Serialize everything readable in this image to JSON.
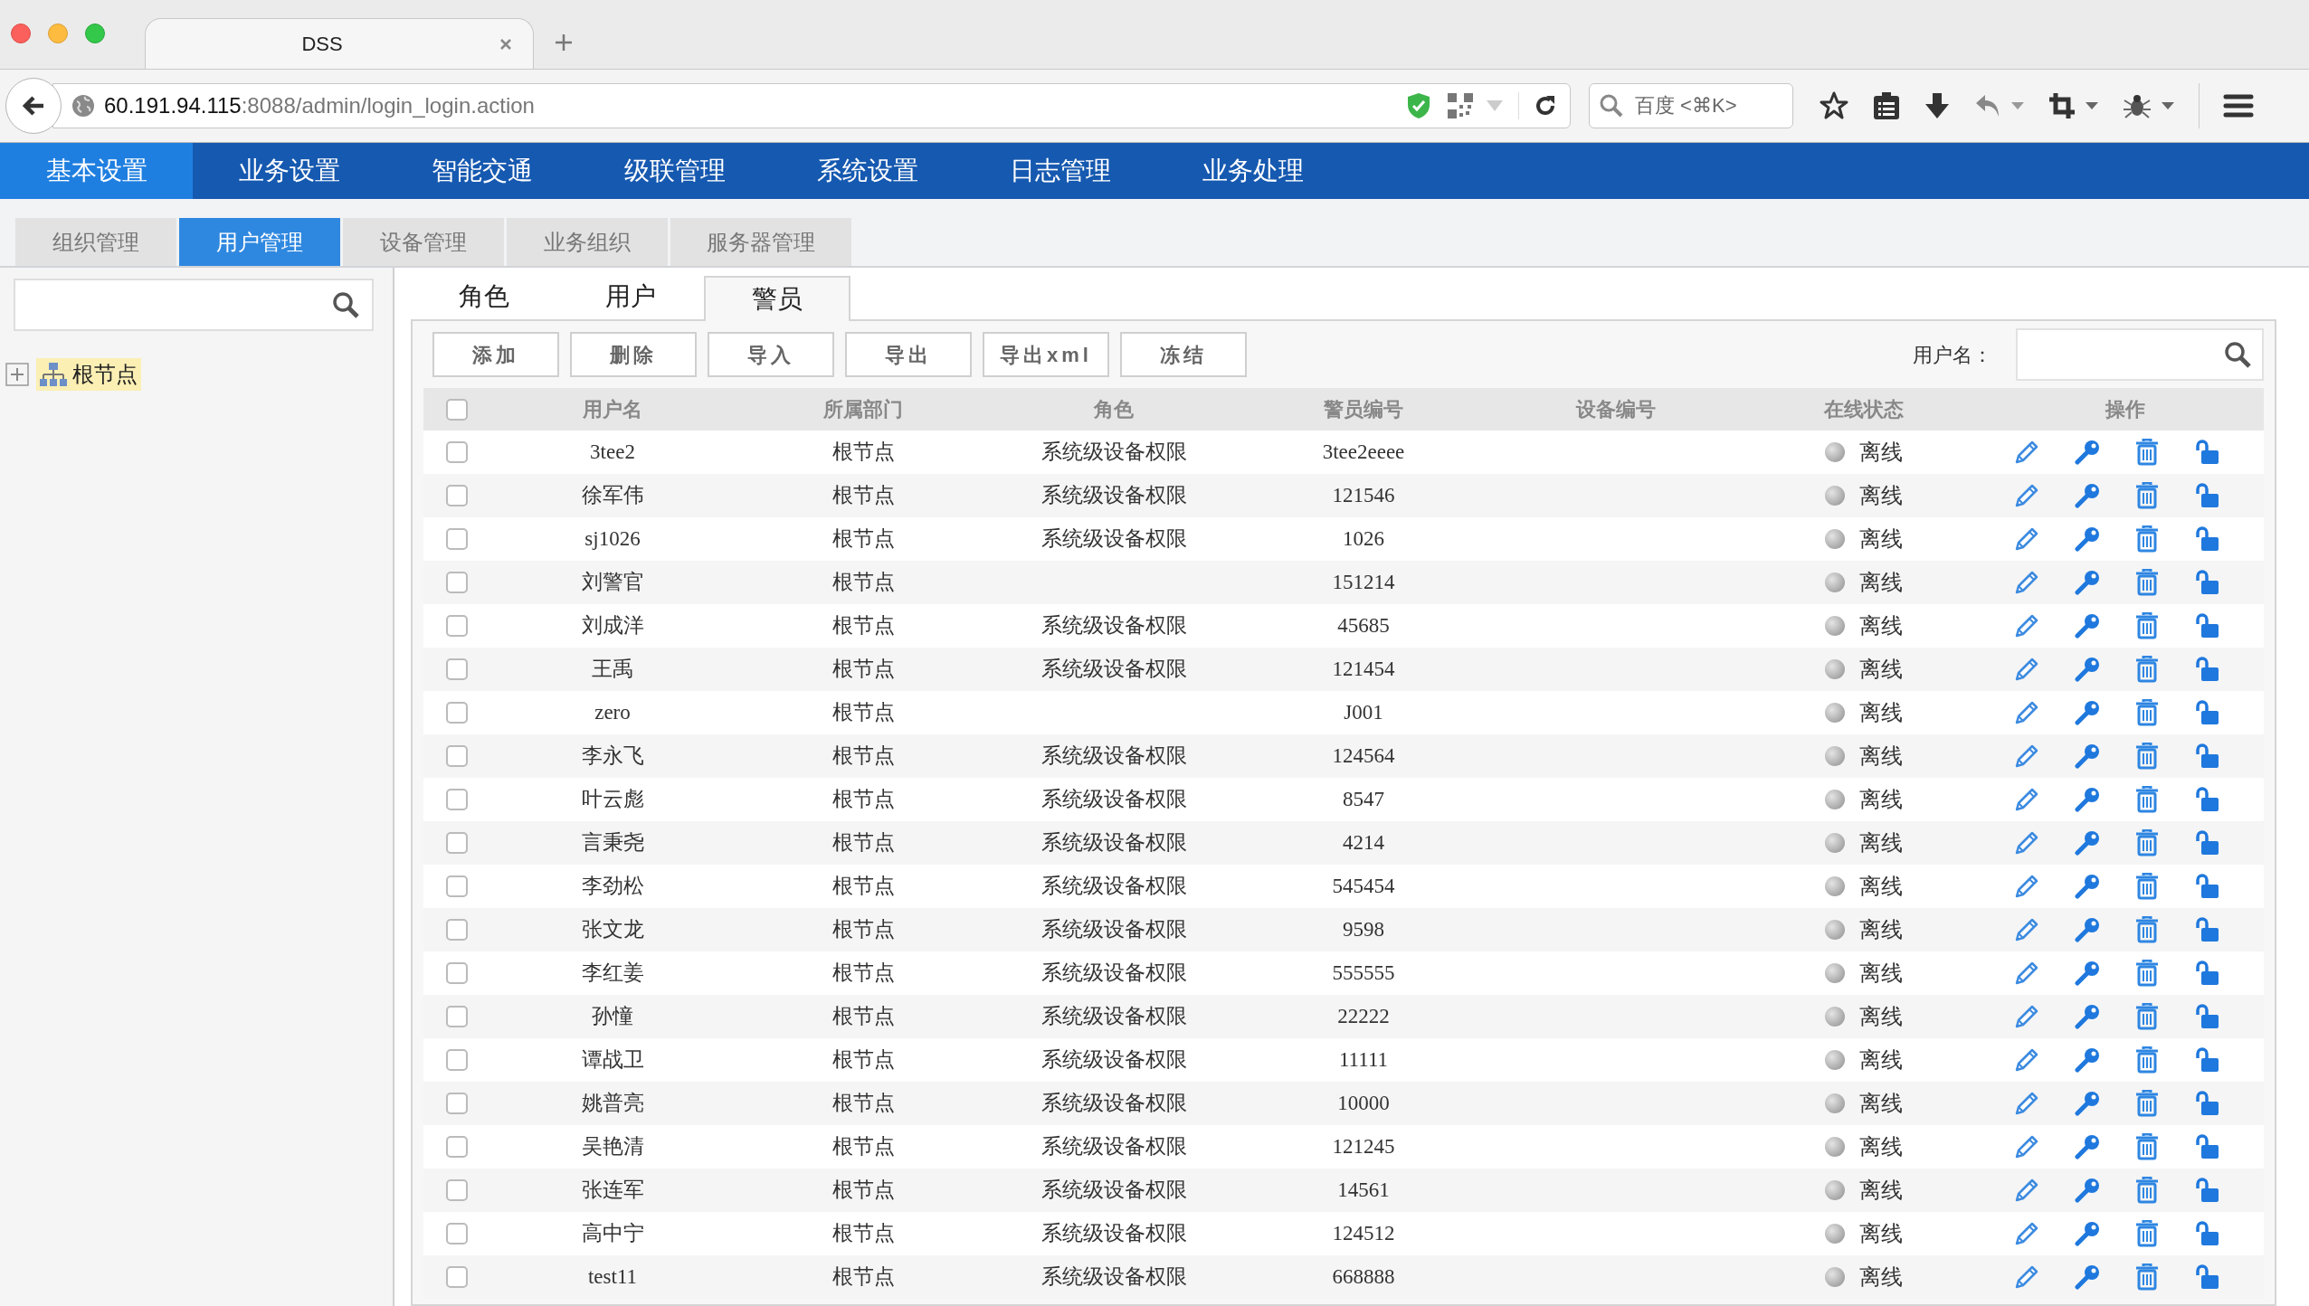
{
  "browser": {
    "tab_title": "DSS",
    "url_host": "60.191.94.115",
    "url_rest": ":8088/admin/login_login.action",
    "search_placeholder": "百度 <⌘K>"
  },
  "nav": [
    {
      "label": "基本设置",
      "selected": true
    },
    {
      "label": "业务设置",
      "selected": false
    },
    {
      "label": "智能交通",
      "selected": false
    },
    {
      "label": "级联管理",
      "selected": false
    },
    {
      "label": "系统设置",
      "selected": false
    },
    {
      "label": "日志管理",
      "selected": false
    },
    {
      "label": "业务处理",
      "selected": false
    }
  ],
  "subnav": [
    {
      "label": "组织管理",
      "selected": false
    },
    {
      "label": "用户管理",
      "selected": true
    },
    {
      "label": "设备管理",
      "selected": false
    },
    {
      "label": "业务组织",
      "selected": false
    },
    {
      "label": "服务器管理",
      "selected": false
    }
  ],
  "sidebar": {
    "tree": [
      {
        "label": "根节点",
        "expanded": false,
        "selected": true
      }
    ]
  },
  "tabs": [
    {
      "label": "角色",
      "selected": false
    },
    {
      "label": "用户",
      "selected": false
    },
    {
      "label": "警员",
      "selected": true
    }
  ],
  "toolbar": {
    "buttons": [
      "添加",
      "删除",
      "导入",
      "导出",
      "导出xml",
      "冻结"
    ],
    "search_label": "用户名："
  },
  "table": {
    "select_all_checked": false,
    "columns": [
      "用户名",
      "所属部门",
      "角色",
      "警员编号",
      "设备编号",
      "在线状态",
      "操作"
    ],
    "rows": [
      {
        "username": "3tee2",
        "department": "根节点",
        "role": "系统级设备权限",
        "badge": "3tee2eeee",
        "status": "离线",
        "online": false,
        "checked": false
      },
      {
        "username": "徐军伟",
        "department": "根节点",
        "role": "系统级设备权限",
        "badge": "121546",
        "status": "离线",
        "online": false,
        "checked": false
      },
      {
        "username": "sj1026",
        "department": "根节点",
        "role": "系统级设备权限",
        "badge": "1026",
        "status": "离线",
        "online": false,
        "checked": false
      },
      {
        "username": "刘警官",
        "department": "根节点",
        "badge": "151214",
        "status": "离线",
        "online": false,
        "checked": false
      },
      {
        "username": "刘成洋",
        "department": "根节点",
        "role": "系统级设备权限",
        "badge": "45685",
        "status": "离线",
        "online": false,
        "checked": false
      },
      {
        "username": "王禹",
        "department": "根节点",
        "role": "系统级设备权限",
        "badge": "121454",
        "status": "离线",
        "online": false,
        "checked": false
      },
      {
        "username": "zero",
        "department": "根节点",
        "badge": "J001",
        "status": "离线",
        "online": false,
        "checked": false
      },
      {
        "username": "李永飞",
        "department": "根节点",
        "role": "系统级设备权限",
        "badge": "124564",
        "status": "离线",
        "online": false,
        "checked": false
      },
      {
        "username": "叶云彪",
        "department": "根节点",
        "role": "系统级设备权限",
        "badge": "8547",
        "status": "离线",
        "online": false,
        "checked": false
      },
      {
        "username": "言秉尧",
        "department": "根节点",
        "role": "系统级设备权限",
        "badge": "4214",
        "status": "离线",
        "online": false,
        "checked": false
      },
      {
        "username": "李劲松",
        "department": "根节点",
        "role": "系统级设备权限",
        "badge": "545454",
        "status": "离线",
        "online": false,
        "checked": false
      },
      {
        "username": "张文龙",
        "department": "根节点",
        "role": "系统级设备权限",
        "badge": "9598",
        "status": "离线",
        "online": false,
        "checked": false
      },
      {
        "username": "李红姜",
        "department": "根节点",
        "role": "系统级设备权限",
        "badge": "555555",
        "status": "离线",
        "online": false,
        "checked": false
      },
      {
        "username": "孙憧",
        "department": "根节点",
        "role": "系统级设备权限",
        "badge": "22222",
        "status": "离线",
        "online": false,
        "checked": false
      },
      {
        "username": "谭战卫",
        "department": "根节点",
        "role": "系统级设备权限",
        "badge": "11111",
        "status": "离线",
        "online": false,
        "checked": false
      },
      {
        "username": "姚普亮",
        "department": "根节点",
        "role": "系统级设备权限",
        "badge": "10000",
        "status": "离线",
        "online": false,
        "checked": false
      },
      {
        "username": "吴艳清",
        "department": "根节点",
        "role": "系统级设备权限",
        "badge": "121245",
        "status": "离线",
        "online": false,
        "checked": false
      },
      {
        "username": "张连军",
        "department": "根节点",
        "role": "系统级设备权限",
        "badge": "14561",
        "status": "离线",
        "online": false,
        "checked": false
      },
      {
        "username": "高中宁",
        "department": "根节点",
        "role": "系统级设备权限",
        "badge": "124512",
        "status": "离线",
        "online": false,
        "checked": false
      },
      {
        "username": "test11",
        "department": "根节点",
        "role": "系统级设备权限",
        "badge": "668888",
        "status": "离线",
        "online": false,
        "checked": false
      }
    ]
  }
}
